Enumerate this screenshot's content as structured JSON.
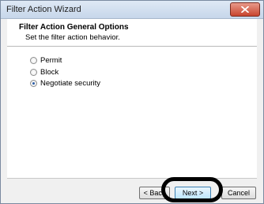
{
  "window": {
    "title": "Filter Action Wizard"
  },
  "header": {
    "title": "Filter Action General Options",
    "subtitle": "Set the filter action behavior."
  },
  "options": [
    {
      "label": "Permit",
      "checked": false
    },
    {
      "label": "Block",
      "checked": false
    },
    {
      "label": "Negotiate security",
      "checked": true
    }
  ],
  "buttons": {
    "back": "< Back",
    "next": "Next >",
    "cancel": "Cancel"
  },
  "colors": {
    "close_button": "#c8452f",
    "selected_radio": "#2c5fa8",
    "highlight_ring": "#000000"
  }
}
